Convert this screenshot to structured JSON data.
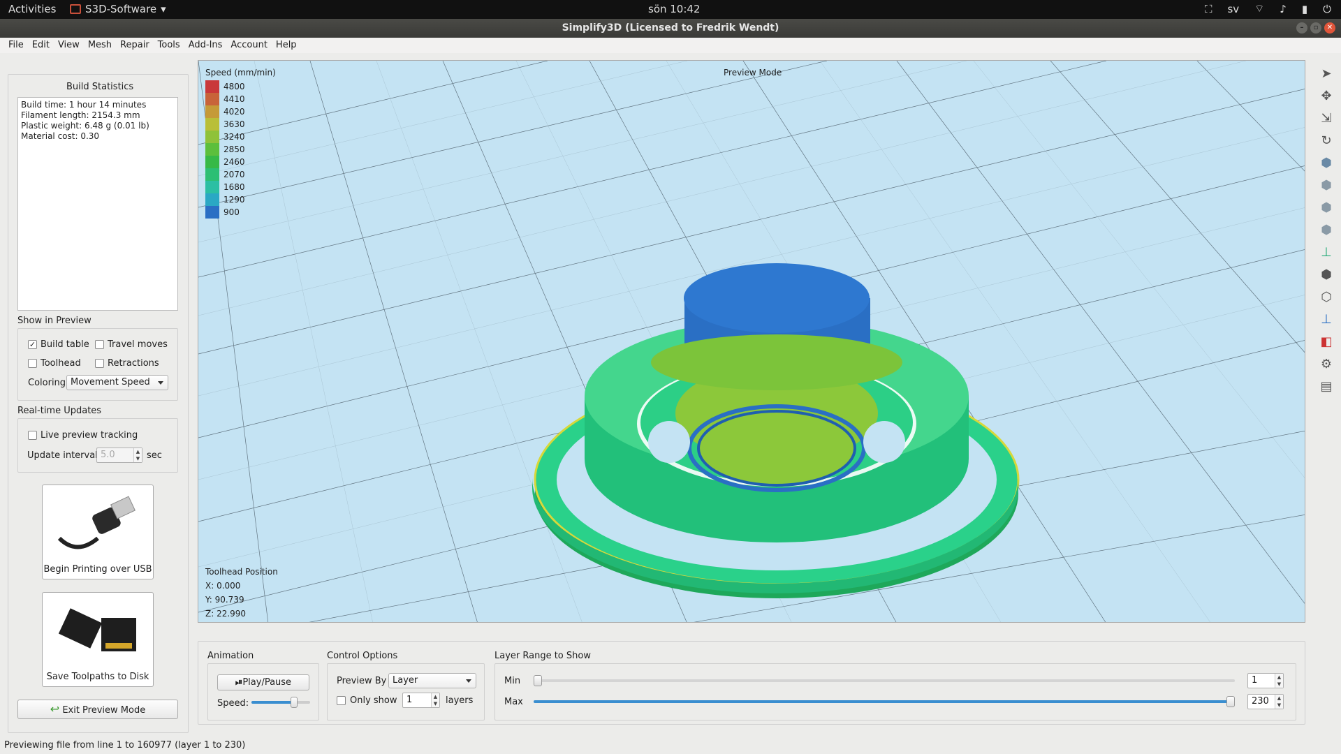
{
  "topbar": {
    "activities": "Activities",
    "app": "S3D-Software",
    "clock": "sön 10:42",
    "lang": "sv"
  },
  "window": {
    "title": "Simplify3D (Licensed to Fredrik Wendt)"
  },
  "menu": [
    "File",
    "Edit",
    "View",
    "Mesh",
    "Repair",
    "Tools",
    "Add-Ins",
    "Account",
    "Help"
  ],
  "stats": {
    "title": "Build Statistics",
    "lines": [
      "Build time: 1 hour 14 minutes",
      "Filament length: 2154.3 mm",
      "Plastic weight: 6.48 g (0.01 lb)",
      "Material cost: 0.30"
    ]
  },
  "show": {
    "title": "Show in Preview",
    "build_table": "Build table",
    "build_table_checked": true,
    "travel": "Travel moves",
    "toolhead": "Toolhead",
    "retractions": "Retractions",
    "coloring_label": "Coloring",
    "coloring_value": "Movement Speed"
  },
  "realtime": {
    "title": "Real-time Updates",
    "live": "Live preview tracking",
    "interval_label": "Update interval",
    "interval_value": "5.0",
    "unit": "sec"
  },
  "buttons": {
    "usb": "Begin Printing over USB",
    "disk": "Save Toolpaths to Disk",
    "exit": "Exit Preview Mode"
  },
  "viewport": {
    "legend_title": "Speed (mm/min)",
    "mode": "Preview Mode",
    "legend": [
      {
        "v": "4800",
        "c": "#c9383a"
      },
      {
        "v": "4410",
        "c": "#c8633a"
      },
      {
        "v": "4020",
        "c": "#c59a38"
      },
      {
        "v": "3630",
        "c": "#b9bf38"
      },
      {
        "v": "3240",
        "c": "#8fc23a"
      },
      {
        "v": "2850",
        "c": "#5cbf3c"
      },
      {
        "v": "2460",
        "c": "#36b947"
      },
      {
        "v": "2070",
        "c": "#2cbf74"
      },
      {
        "v": "1680",
        "c": "#2bbfa3"
      },
      {
        "v": "1290",
        "c": "#2aa8c4"
      },
      {
        "v": "900",
        "c": "#2a6fc4"
      }
    ],
    "toolhead_title": "Toolhead Position",
    "x": "X: 0.000",
    "y": "Y: 90.739",
    "z": "Z: 22.990"
  },
  "animation": {
    "title": "Animation",
    "play": "Play/Pause",
    "speed": "Speed:",
    "speed_value": 0.75
  },
  "control": {
    "title": "Control Options",
    "preview_by": "Preview By",
    "preview_value": "Layer",
    "only_show": "Only show",
    "only_value": "1",
    "layers": "layers"
  },
  "range": {
    "title": "Layer Range to Show",
    "min": "Min",
    "max": "Max",
    "min_value": "1",
    "max_value": "230",
    "min_fraction": 0,
    "max_fraction": 1
  },
  "status": "Previewing file from line 1 to 160977 (layer 1 to 230)"
}
